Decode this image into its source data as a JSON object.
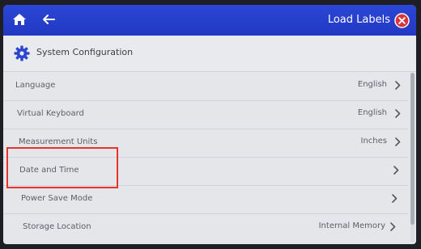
{
  "header": {
    "title": "Load Labels",
    "home_icon": "home-icon",
    "back_icon": "back-arrow-icon",
    "close_icon": "close-circle-icon",
    "bar_color": "#2540cf",
    "close_color": "#d8343d"
  },
  "section": {
    "title": "System Configuration",
    "icon": "gear-icon",
    "icon_color": "#2a46cf"
  },
  "settings": {
    "language": {
      "label": "Language",
      "value": "English"
    },
    "virtual_keyboard": {
      "label": "Virtual Keyboard",
      "value": "English"
    },
    "measurement_units": {
      "label": "Measurement Units",
      "value": "Inches"
    },
    "date_time": {
      "label": "Date and Time",
      "value": ""
    },
    "power_save": {
      "label": "Power Save Mode",
      "value": ""
    },
    "storage_location": {
      "label": "Storage Location",
      "value": "Internal Memory"
    }
  },
  "annotation": {
    "highlighted_item": "Date and Time",
    "color": "#e5352b"
  }
}
